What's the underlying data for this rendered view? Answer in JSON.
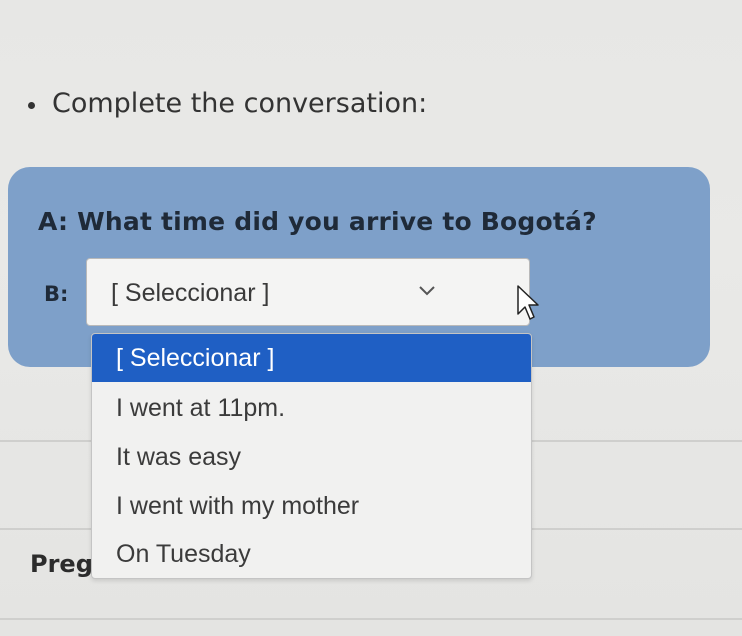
{
  "instruction": "Complete the conversation:",
  "question": {
    "prompt": "A: What time did you arrive to Bogotá?",
    "answer_label": "B:",
    "select_value": "[ Seleccionar ]"
  },
  "dropdown": {
    "options": [
      "[ Seleccionar ]",
      "I went at 11pm.",
      "It was easy",
      "I went with my mother",
      "On Tuesday"
    ],
    "highlighted_index": 0
  },
  "footer_partial_text": "Preg",
  "colors": {
    "question_box": "#7ea0c9",
    "highlight": "#1f5fc4"
  }
}
